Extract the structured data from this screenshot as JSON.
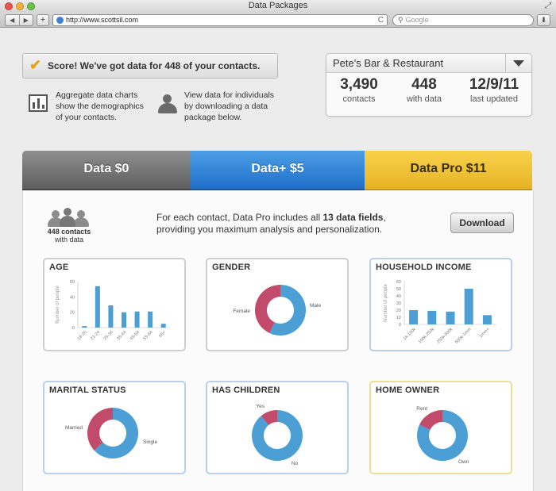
{
  "window": {
    "title": "Data Packages"
  },
  "toolbar": {
    "back": "◀",
    "forward": "▶",
    "add": "+",
    "url": "http://www.scottsil.com",
    "search_placeholder": "Google",
    "reload": "C"
  },
  "banner": {
    "score_text": "Score! We've got data for 448 of your contacts."
  },
  "info": {
    "charts_text_1": "Aggregate data charts",
    "charts_text_2": "show the demographics",
    "charts_text_3": "of your contacts.",
    "indiv_text_1": "View data for individuals",
    "indiv_text_2": "by downloading a data",
    "indiv_text_3": "package below."
  },
  "account": {
    "name": "Pete's Bar & Restaurant",
    "stats": [
      {
        "value": "3,490",
        "label": "contacts"
      },
      {
        "value": "448",
        "label": "with data"
      },
      {
        "value": "12/9/11",
        "label": "last updated"
      }
    ]
  },
  "tabs": [
    {
      "label": "Data  $0"
    },
    {
      "label": "Data+  $5"
    },
    {
      "label": "Data Pro  $11"
    }
  ],
  "content": {
    "contacts_count": "448 contacts",
    "contacts_sub": "with data",
    "desc_prefix": "For each contact, Data Pro includes all ",
    "desc_bold": "13 data fields",
    "desc_suffix": ",",
    "desc_line2": "providing you maximum analysis and personalization.",
    "download": "Download"
  },
  "colors": {
    "blue": "#4b9fd5",
    "red": "#c24a6a",
    "tab_gray": "#6f6f6f",
    "tab_blue": "#2f7fd8",
    "tab_yellow": "#f0c43a"
  },
  "chart_data": [
    {
      "type": "bar",
      "title": "AGE",
      "ylabel": "Number of people",
      "ylim": [
        0,
        60
      ],
      "yticks": [
        0,
        20,
        40,
        60
      ],
      "categories": [
        "18-20",
        "21-24",
        "25-34",
        "35-44",
        "45-54",
        "55-64",
        "65+"
      ],
      "values": [
        2,
        54,
        29,
        20,
        21,
        21,
        5
      ]
    },
    {
      "type": "pie",
      "title": "GENDER",
      "labels": [
        "Female",
        "Male"
      ],
      "values": [
        43,
        57
      ]
    },
    {
      "type": "bar",
      "title": "HOUSEHOLD INCOME",
      "ylabel": "Number of people",
      "ylim": [
        0,
        60
      ],
      "yticks": [
        0,
        10,
        20,
        30,
        40,
        50,
        60
      ],
      "categories": [
        "1k-100k",
        "100k-250k",
        "250k-500k",
        "500k-1mm",
        "1mm+"
      ],
      "values": [
        20,
        19,
        18,
        50,
        13
      ]
    },
    {
      "type": "pie",
      "title": "MARITAL STATUS",
      "labels": [
        "Married",
        "Single"
      ],
      "values": [
        37,
        63
      ]
    },
    {
      "type": "pie",
      "title": "HAS CHILDREN",
      "labels": [
        "Yes",
        "No"
      ],
      "values": [
        11,
        89
      ]
    },
    {
      "type": "pie",
      "title": "HOME OWNER",
      "labels": [
        "Rent",
        "Own"
      ],
      "values": [
        18,
        82
      ]
    }
  ]
}
